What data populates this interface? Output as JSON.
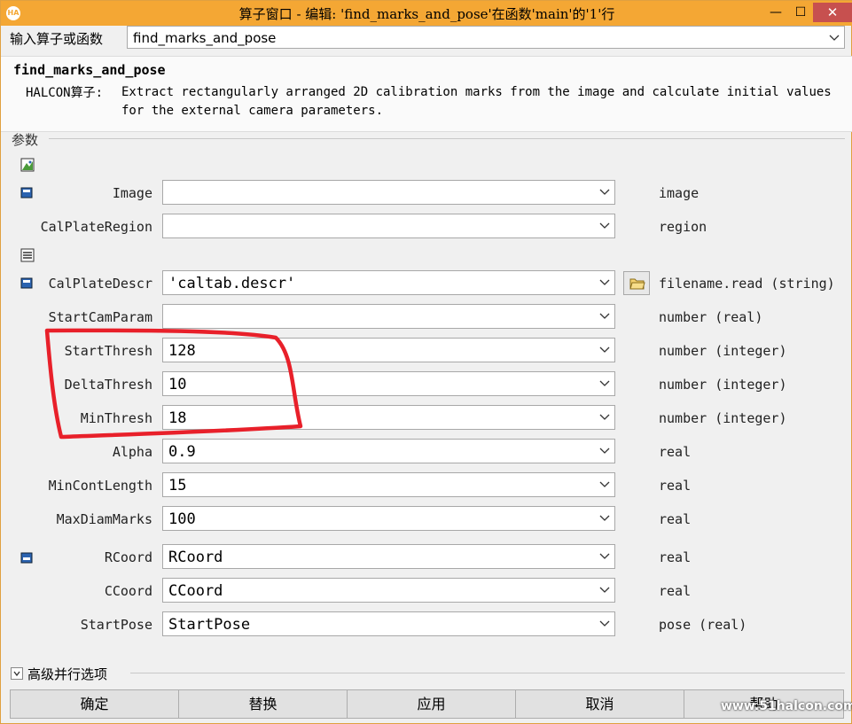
{
  "window": {
    "app_icon": "HA",
    "title": "算子窗口 - 编辑: 'find_marks_and_pose'在函数'main'的'1'行",
    "min": "—",
    "max": "☐",
    "close": "✕"
  },
  "selector": {
    "label": "输入算子或函数",
    "value": "find_marks_and_pose"
  },
  "operator": {
    "name": "find_marks_and_pose",
    "prefix": "HALCON算子:",
    "description": "Extract rectangularly arranged 2D calibration marks from the image and calculate initial values for the external camera parameters."
  },
  "section_label": "参数",
  "params": {
    "image": {
      "label": "Image",
      "value": "",
      "type": "image"
    },
    "calplateregion": {
      "label": "CalPlateRegion",
      "value": "",
      "type": "region"
    },
    "calplatedescr": {
      "label": "CalPlateDescr",
      "value": "'caltab.descr'",
      "type": "filename.read (string)"
    },
    "startcamparam": {
      "label": "StartCamParam",
      "value": "",
      "type": "number (real)"
    },
    "startthresh": {
      "label": "StartThresh",
      "value": "128",
      "type": "number (integer)"
    },
    "deltathresh": {
      "label": "DeltaThresh",
      "value": "10",
      "type": "number (integer)"
    },
    "minthresh": {
      "label": "MinThresh",
      "value": "18",
      "type": "number (integer)"
    },
    "alpha": {
      "label": "Alpha",
      "value": "0.9",
      "type": "real"
    },
    "mincontlength": {
      "label": "MinContLength",
      "value": "15",
      "type": "real"
    },
    "maxdiammarks": {
      "label": "MaxDiamMarks",
      "value": "100",
      "type": "real"
    },
    "rcoord": {
      "label": "RCoord",
      "value": "RCoord",
      "type": "real"
    },
    "ccoord": {
      "label": "CCoord",
      "value": "CCoord",
      "type": "real"
    },
    "startpose": {
      "label": "StartPose",
      "value": "StartPose",
      "type": "pose (real)"
    }
  },
  "advanced": {
    "label": "高级并行选项"
  },
  "buttons": {
    "ok": "确定",
    "replace": "替换",
    "apply": "应用",
    "cancel": "取消",
    "help": "帮助"
  },
  "watermark": "www.51halcon.com",
  "colors": {
    "titlebar": "#f4a734",
    "highlight": "#e8202a",
    "close": "#c7504f"
  }
}
